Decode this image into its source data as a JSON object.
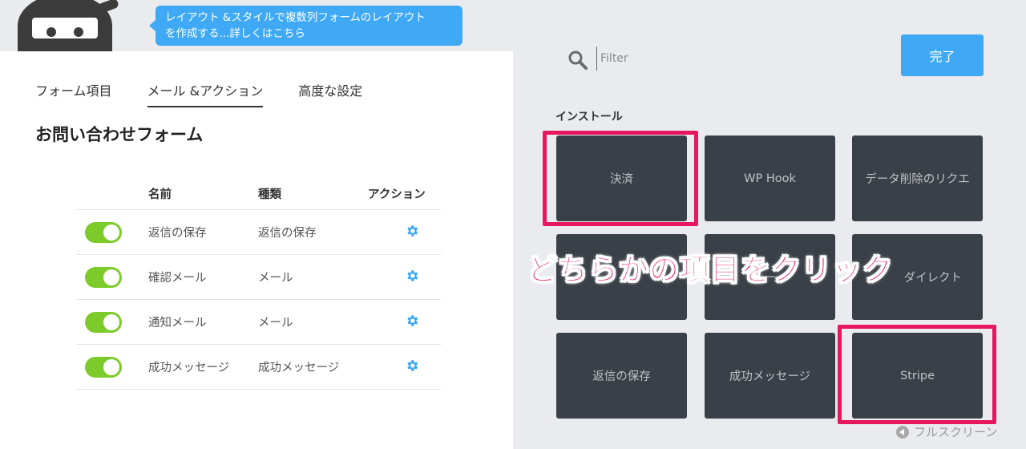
{
  "tooltip": {
    "line1": "レイアウト &スタイルで複数列フォームのレイアウト",
    "line2": "を作成する...詳しくはこちら"
  },
  "tabs": [
    {
      "label": "フォーム項目",
      "active": false
    },
    {
      "label": "メール &アクション",
      "active": true
    },
    {
      "label": "高度な設定",
      "active": false
    }
  ],
  "form_title": "お問い合わせフォーム",
  "table": {
    "headers": {
      "name": "名前",
      "type": "種類",
      "action": "アクション"
    },
    "rows": [
      {
        "name": "返信の保存",
        "type": "返信の保存",
        "enabled": true
      },
      {
        "name": "確認メール",
        "type": "メール",
        "enabled": true
      },
      {
        "name": "通知メール",
        "type": "メール",
        "enabled": true
      },
      {
        "name": "成功メッセージ",
        "type": "成功メッセージ",
        "enabled": true
      }
    ]
  },
  "search": {
    "placeholder": "Filter"
  },
  "done_label": "完了",
  "section_label": "インストール",
  "tiles": [
    {
      "label": "決済",
      "highlighted": true
    },
    {
      "label": "WP Hook",
      "highlighted": false
    },
    {
      "label": "データ削除のリクエ",
      "highlighted": false
    },
    {
      "label": "",
      "highlighted": false
    },
    {
      "label": "ー",
      "highlighted": false
    },
    {
      "label": "ダイレクト",
      "highlighted": false
    },
    {
      "label": "返信の保存",
      "highlighted": false
    },
    {
      "label": "成功メッセージ",
      "highlighted": false
    },
    {
      "label": "Stripe",
      "highlighted": true
    }
  ],
  "overlay_text": "どちらかの項目をクリック",
  "fullscreen_label": "フルスクリーン",
  "colors": {
    "accent": "#3fa9f5",
    "toggle_on": "#7dcb2a",
    "highlight": "#e6175c",
    "tile": "#3a4047"
  }
}
